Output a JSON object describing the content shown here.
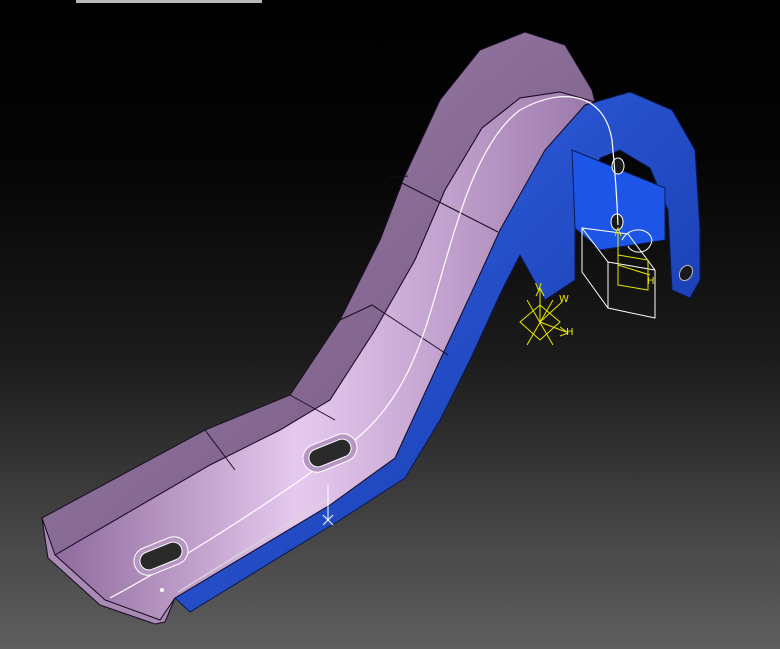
{
  "viewport": {
    "background_top": "#000000",
    "background_bottom": "#5e5e5e"
  },
  "part": {
    "face_color": "#c9a2d6",
    "side_color": "#1f4ed8",
    "edge_color": "#1a0d22"
  },
  "compass": {
    "color": "#e8e800",
    "label_v": "V",
    "label_h": "H",
    "label_w": "W"
  },
  "local_axis": {
    "color": "#e8e800",
    "label_h": "H"
  }
}
